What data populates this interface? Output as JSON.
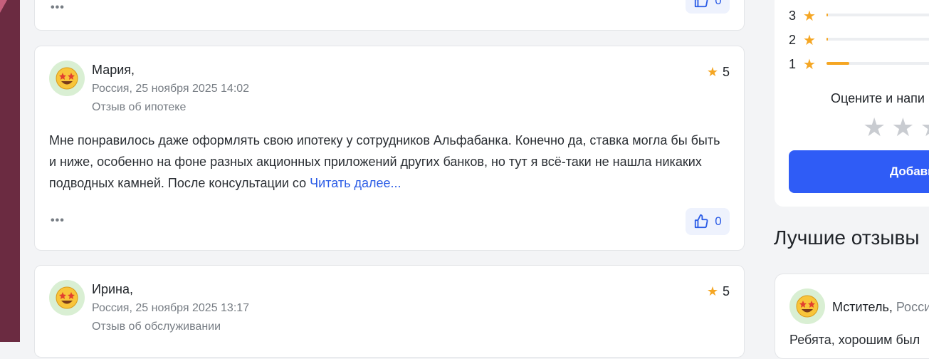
{
  "reviews": [
    {
      "author": "Мария,",
      "location_date": "Россия, 25 ноября 2025 14:02",
      "category": "Отзыв об ипотеке",
      "rating": "5",
      "text": "Мне понравилось даже оформлять свою ипотеку у сотрудников Альфабанка. Конечно да, ставка могла бы быть и ниже, особенно на фоне разных акционных приложений других банков, но тут я всё-таки не нашла никаких подводных камней. После консультации со ",
      "read_more": "Читать далее...",
      "likes": "0"
    },
    {
      "author": "Ирина,",
      "location_date": "Россия, 25 ноября 2025 13:17",
      "category": "Отзыв об обслуживании",
      "rating": "5"
    }
  ],
  "top_card": {
    "likes": "0",
    "more": "•••"
  },
  "more_label": "•••",
  "sidebar": {
    "bars": [
      {
        "stars": "3",
        "fraction": 0.01
      },
      {
        "stars": "2",
        "fraction": 0.01
      },
      {
        "stars": "1",
        "fraction": 0.16
      }
    ],
    "rate_prompt": "Оцените и напи",
    "add_button": "Добавь"
  },
  "best": {
    "title": "Лучшие отзывы",
    "author": "Мститель,",
    "country": " Росси",
    "text": "Ребята, хорошим был"
  },
  "colors": {
    "accent": "#2f5cf6",
    "star": "#f5a623",
    "link": "#2b5ce6"
  }
}
